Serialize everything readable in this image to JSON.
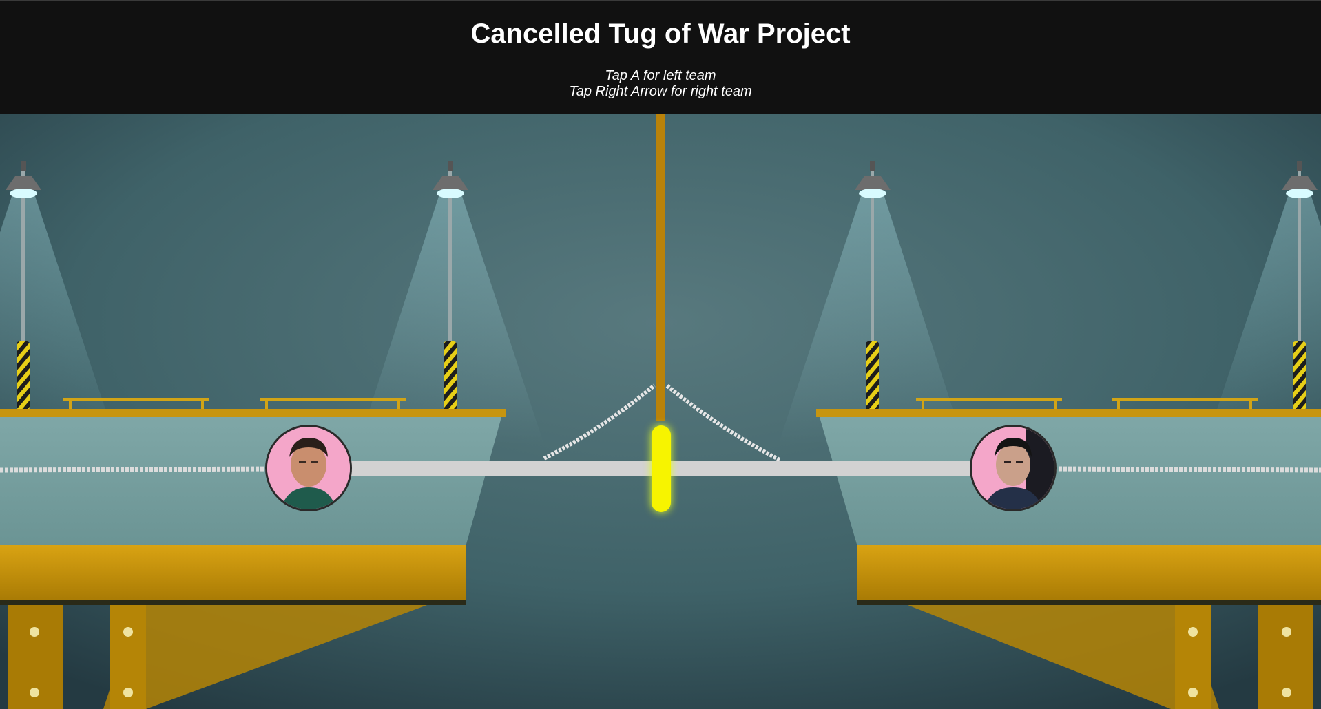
{
  "header": {
    "title": "Cancelled Tug of War Project",
    "instruction_left": "Tap A for left team",
    "instruction_right": "Tap Right Arrow for right team"
  },
  "game": {
    "left_team": {
      "key": "A",
      "avatar": "player-portrait"
    },
    "right_team": {
      "key": "Right Arrow",
      "avatar": "player-portrait"
    },
    "colors": {
      "header_bg": "#111111",
      "marker": "#f7f400",
      "rope_bar": "#d2d2d2",
      "platform": "#b98a06",
      "background": "#4f7176"
    }
  }
}
